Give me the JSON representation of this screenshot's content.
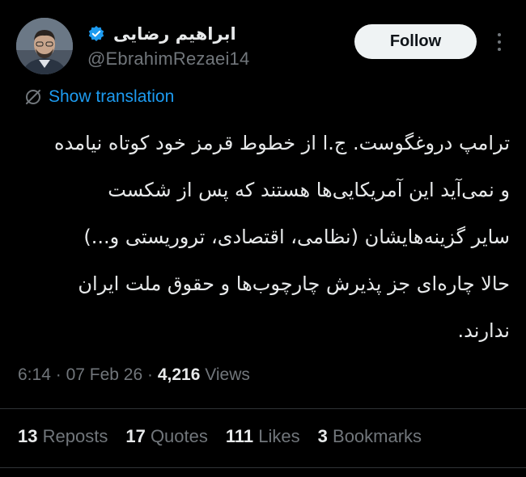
{
  "author": {
    "display_name": "ابراهیم رضایی",
    "handle": "@EbrahimRezaei14",
    "verified": true,
    "verified_color": "#1d9bf0"
  },
  "follow_label": "Follow",
  "translation_label": "Show translation",
  "tweet": {
    "lines": [
      "ترامپ دروغگوست. ج.ا از خطوط قرمز خود کوتاه نیامده",
      "و نمی‌آید این آمریکایی‌ها هستند که پس از شکست",
      "سایر گزینه‌هایشان (نظامی، اقتصادی، تروریستی و...)",
      "حالا چاره‌ای جز پذیرش چارچوب‌ها و حقوق ملت ایران",
      "ندارند."
    ]
  },
  "meta": {
    "time": "6:14",
    "date": "07 Feb 26",
    "separator": "·",
    "views_count": "4,216",
    "views_label": "Views"
  },
  "stats": {
    "reposts": {
      "count": "13",
      "label": "Reposts"
    },
    "quotes": {
      "count": "17",
      "label": "Quotes"
    },
    "likes": {
      "count": "111",
      "label": "Likes"
    },
    "bookmarks": {
      "count": "3",
      "label": "Bookmarks"
    }
  },
  "colors": {
    "background": "#000000",
    "text": "#e7e9ea",
    "secondary": "#71767b",
    "accent": "#1d9bf0",
    "divider": "#2f3336"
  },
  "icons": {
    "verified": "verified-badge-icon",
    "translate": "translate-globe-icon",
    "more": "more-options-icon"
  }
}
